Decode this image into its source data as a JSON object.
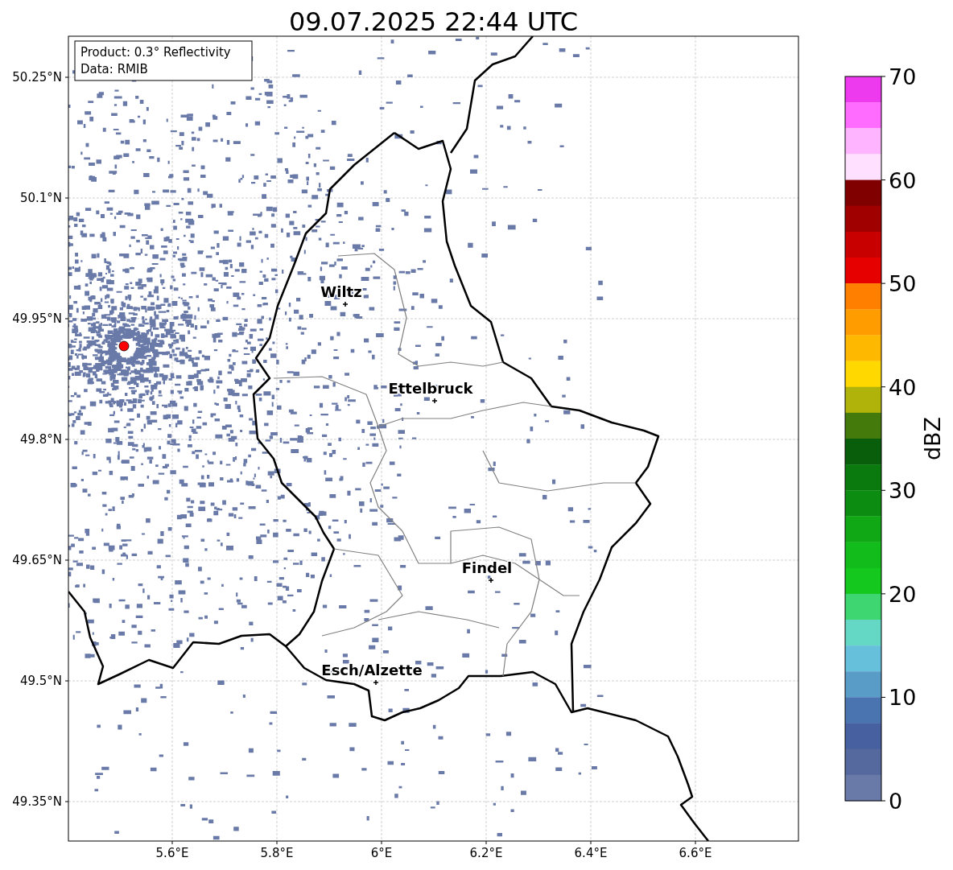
{
  "map": {
    "title": "09.07.2025 22:44 UTC",
    "xticks": [
      "5.6°E",
      "5.8°E",
      "6°E",
      "6.2°E",
      "6.4°E",
      "6.6°E"
    ],
    "yticks": [
      "50.25°N",
      "50.1°N",
      "49.95°N",
      "49.8°N",
      "49.65°N",
      "49.5°N",
      "49.35°N"
    ],
    "cities": [
      {
        "name": "Wiltz"
      },
      {
        "name": "Ettelbruck"
      },
      {
        "name": "Findel"
      },
      {
        "name": "Esch/Alzette"
      }
    ]
  },
  "legend": [
    "Product: 0.3° Reflectivity",
    "Data: RMIB"
  ],
  "colorbar": {
    "label": "dBZ",
    "ticks": [
      "70",
      "60",
      "50",
      "40",
      "30",
      "20",
      "10",
      "0"
    ],
    "bins": [
      {
        "color": "#ee3aee"
      },
      {
        "color": "#ff6cff"
      },
      {
        "color": "#ffb4ff"
      },
      {
        "color": "#ffe0ff"
      },
      {
        "color": "#800000"
      },
      {
        "color": "#a00000"
      },
      {
        "color": "#c80000"
      },
      {
        "color": "#e60000"
      },
      {
        "color": "#ff8000"
      },
      {
        "color": "#ff9c00"
      },
      {
        "color": "#ffb800"
      },
      {
        "color": "#ffd800"
      },
      {
        "color": "#b0b40a"
      },
      {
        "color": "#447a0c"
      },
      {
        "color": "#085e0a"
      },
      {
        "color": "#0a7a0e"
      },
      {
        "color": "#0c8c10"
      },
      {
        "color": "#10a814"
      },
      {
        "color": "#12bc1a"
      },
      {
        "color": "#14c81e"
      },
      {
        "color": "#3ed670"
      },
      {
        "color": "#64d8c4"
      },
      {
        "color": "#66c0dc"
      },
      {
        "color": "#5a9cc8"
      },
      {
        "color": "#4a74b0"
      },
      {
        "color": "#4660a0"
      },
      {
        "color": "#56699f"
      },
      {
        "color": "#6a7aa8"
      }
    ]
  }
}
